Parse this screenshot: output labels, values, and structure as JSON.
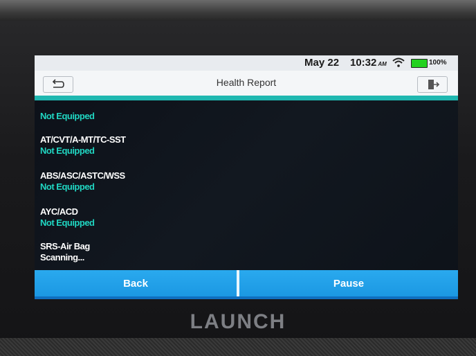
{
  "statusbar": {
    "date": "May 22",
    "time": "10:32",
    "ampm": "AM",
    "battery": "100%",
    "wifi_icon": "wifi-icon",
    "battery_icon": "battery-icon"
  },
  "titlebar": {
    "title": "Health Report",
    "back_icon": "return-arrow-icon",
    "exit_icon": "exit-door-icon"
  },
  "items": [
    {
      "label": "",
      "status": "Not Equipped"
    },
    {
      "label": "AT/CVT/A-MT/TC-SST",
      "status": "Not Equipped"
    },
    {
      "label": "ABS/ASC/ASTC/WSS",
      "status": "Not Equipped"
    },
    {
      "label": "AYC/ACD",
      "status": "Not Equipped"
    },
    {
      "label": "SRS-Air Bag",
      "status": "Scanning..."
    }
  ],
  "actions": {
    "back_label": "Back",
    "pause_label": "Pause"
  },
  "brand": "LAUNCH",
  "colors": {
    "status_accent": "#20d6c2",
    "title_underline": "#1fb7b0",
    "button_blue": "#1b98e3"
  }
}
